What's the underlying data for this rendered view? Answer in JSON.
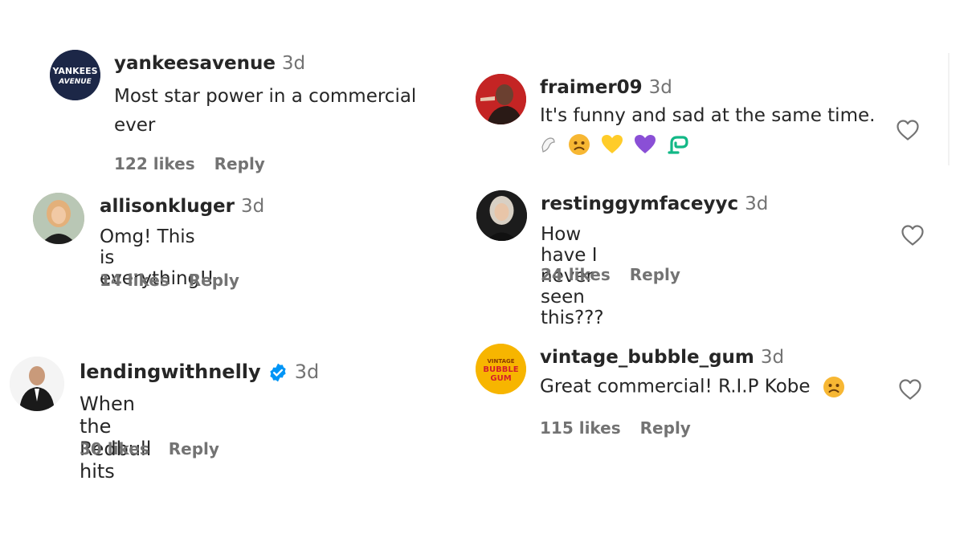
{
  "comments": [
    {
      "username": "yankeesavenue",
      "time": "3d",
      "text": "Most star power in a commercial ever",
      "likes": "122 likes",
      "reply": "Reply",
      "avatar": "YANKEES AVENUE"
    },
    {
      "username": "allisonkluger",
      "time": "3d",
      "text": "Omg! This is everything!!",
      "likes": "14 likes",
      "reply": "Reply"
    },
    {
      "username": "lendingwithnelly",
      "time": "3d",
      "text": "When the Redbull hits",
      "likes": "30 likes",
      "reply": "Reply"
    },
    {
      "username": "fraimer09",
      "time": "3d",
      "text": "It's funny and sad at the same time.",
      "emojis": [
        "dove-icon",
        "sad-face-icon",
        "yellow-heart-icon",
        "purple-heart-icon",
        "green-loop-icon"
      ]
    },
    {
      "username": "restinggymfaceyyc",
      "time": "3d",
      "text": "How have I never seen this???",
      "likes": "24 likes",
      "reply": "Reply"
    },
    {
      "username": "vintage_bubble_gum",
      "time": "3d",
      "text": "Great commercial! R.I.P Kobe",
      "likes": "115 likes",
      "reply": "Reply",
      "avatar": "VINTAGE BUBBLE GUM"
    }
  ],
  "colors": {
    "text": "#262626",
    "muted": "#737373",
    "verified": "#0095f6"
  }
}
